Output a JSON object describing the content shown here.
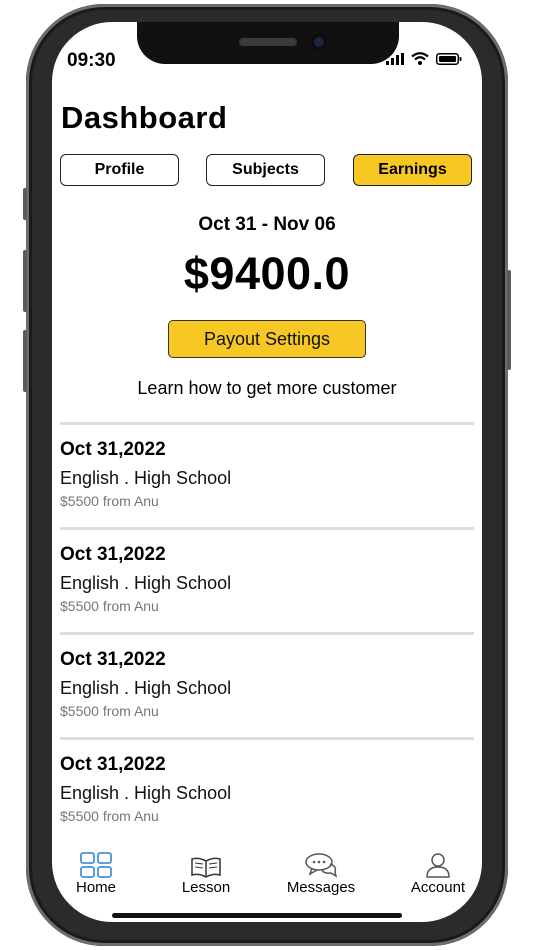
{
  "status_bar": {
    "time": "09:30"
  },
  "header": {
    "title": "Dashboard"
  },
  "tabs": [
    {
      "label": "Profile",
      "active": false
    },
    {
      "label": "Subjects",
      "active": false
    },
    {
      "label": "Earnings",
      "active": true
    }
  ],
  "earnings": {
    "date_range": "Oct 31 - Nov 06",
    "amount": "$9400.0",
    "payout_button": "Payout Settings",
    "learn_link": "Learn how to get more customer"
  },
  "transactions": [
    {
      "date": "Oct 31,2022",
      "subject": "English . High School",
      "from": "$5500 from Anu"
    },
    {
      "date": "Oct 31,2022",
      "subject": "English . High School",
      "from": "$5500 from Anu"
    },
    {
      "date": "Oct 31,2022",
      "subject": "English . High School",
      "from": "$5500 from Anu"
    },
    {
      "date": "Oct 31,2022",
      "subject": "English . High School",
      "from": "$5500 from Anu"
    }
  ],
  "bottom_nav": [
    {
      "label": "Home",
      "icon": "grid-icon",
      "active": true
    },
    {
      "label": "Lesson",
      "icon": "book-icon",
      "active": false
    },
    {
      "label": "Messages",
      "icon": "chat-icon",
      "active": false
    },
    {
      "label": "Account",
      "icon": "person-icon",
      "active": false
    }
  ],
  "colors": {
    "accent": "#f7c824",
    "active_nav": "#4a90d9"
  }
}
